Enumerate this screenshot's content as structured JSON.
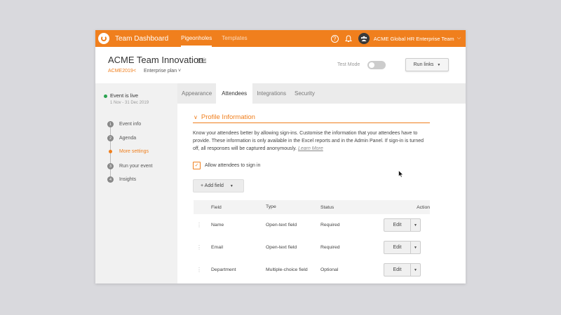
{
  "topbar": {
    "app_title": "Team Dashboard",
    "tabs": [
      {
        "label": "Pigeonholes"
      },
      {
        "label": "Templates"
      }
    ],
    "help_glyph": "?",
    "team_name": "ACME Global HR Enterprise Team",
    "accent": "#f07f1d"
  },
  "header": {
    "event_title": "ACME Team Innovation",
    "edit_label": "Edit",
    "event_code": "ACME2019",
    "plan": "Enterprise plan",
    "test_mode_label": "Test Mode",
    "test_mode_on": false,
    "run_links_label": "Run links"
  },
  "sidebar": {
    "status": "Event is live",
    "dates": "1 Nov - 31 Dec 2019",
    "steps": [
      {
        "num": "1",
        "label": "Event info"
      },
      {
        "num": "2",
        "label": "Agenda"
      },
      {
        "num": "",
        "label": "More settings"
      },
      {
        "num": "3",
        "label": "Run your event"
      },
      {
        "num": "4",
        "label": "Insights"
      }
    ]
  },
  "tabs": [
    {
      "label": "Appearance"
    },
    {
      "label": "Attendees"
    },
    {
      "label": "Integrations"
    },
    {
      "label": "Security"
    }
  ],
  "profile": {
    "section_title": "Profile Information",
    "description": "Know your attendees better by allowing sign-ins. Customise the information that your attendees have to provide. These information is only available in the Excel reports and in the Admin Panel. If sign-in is turned off, all responses will be captured anonymously.",
    "learn_more": "Learn More",
    "checkbox_label": "Allow attendees to sign in",
    "checkbox_checked": true,
    "add_field_label": "+  Add field"
  },
  "table": {
    "headers": {
      "field": "Field",
      "type": "Type",
      "status": "Status",
      "action": "Action"
    },
    "rows": [
      {
        "field": "Name",
        "type": "Open-text field",
        "status": "Required",
        "action": "Edit"
      },
      {
        "field": "Email",
        "type": "Open-text field",
        "status": "Required",
        "action": "Edit"
      },
      {
        "field": "Department",
        "type": "Multiple-choice field",
        "status": "Optional",
        "action": "Edit"
      }
    ]
  }
}
